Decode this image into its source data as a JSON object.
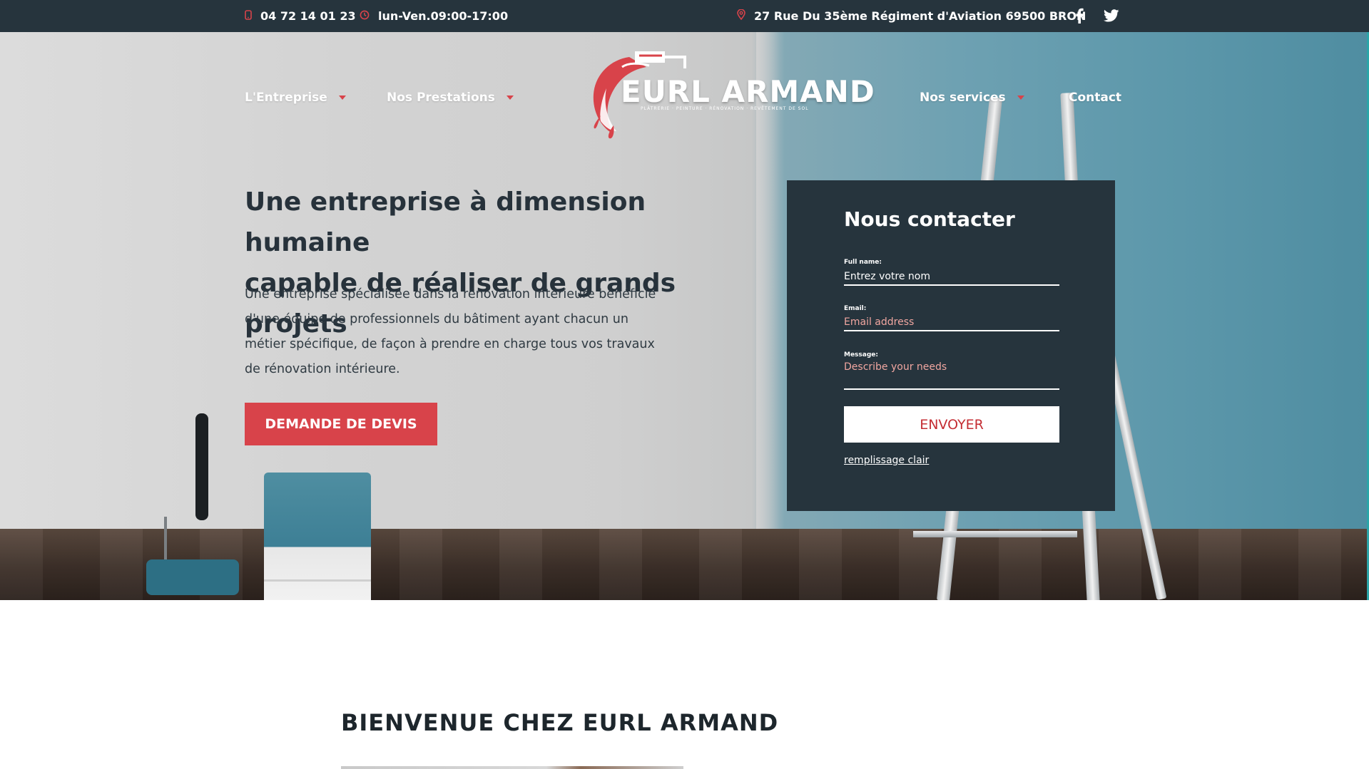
{
  "topbar": {
    "phone": "04 72 14 01 23",
    "hours": "lun-Ven.09:00-17:00",
    "address": "27 Rue Du 35ème Régiment d'Aviation 69500 BRON",
    "phone_icon": "phone-icon",
    "hours_icon": "clock-icon",
    "address_icon": "map-pin-icon",
    "socials": [
      "facebook-icon",
      "twitter-icon"
    ]
  },
  "nav": {
    "left": [
      {
        "label": "L'Entreprise",
        "has_dropdown": true
      },
      {
        "label": "Nos Prestations",
        "has_dropdown": true
      }
    ],
    "right": [
      {
        "label": "Nos services",
        "has_dropdown": true
      },
      {
        "label": "Contact",
        "has_dropdown": false
      }
    ]
  },
  "logo": {
    "name": "EURL ARMAND",
    "tagline": "PLÂTRERIE · PEINTURE · RÉNOVATION · REVÊTEMENT DE SOL"
  },
  "hero": {
    "title_line1": "Une entreprise à dimension humaine",
    "title_line2": "capable de réaliser de grands projets",
    "desc_line1": "Une entreprise spécialisée dans la rénovation intérieure bénéficie",
    "desc_line2": "d'une équipe de professionnels du bâtiment ayant chacun un",
    "desc_line3": "métier spécifique, de façon à prendre en charge tous vos travaux",
    "desc_line4": "de rénovation intérieure.",
    "cta": "DEMANDE DE DEVIS"
  },
  "contact": {
    "title": "Nous contacter",
    "name_label": "Full name:",
    "name_placeholder": "Entrez votre nom",
    "email_label": "Email:",
    "email_placeholder": "Email address",
    "message_label": "Message:",
    "message_placeholder": "Describe your needs",
    "submit": "ENVOYER",
    "clear": "remplissage clair"
  },
  "section": {
    "title": "BIENVENUE CHEZ EURL ARMAND"
  },
  "colors": {
    "dark": "#26343d",
    "accent": "#d8434a",
    "button_text": "#c42d33"
  }
}
